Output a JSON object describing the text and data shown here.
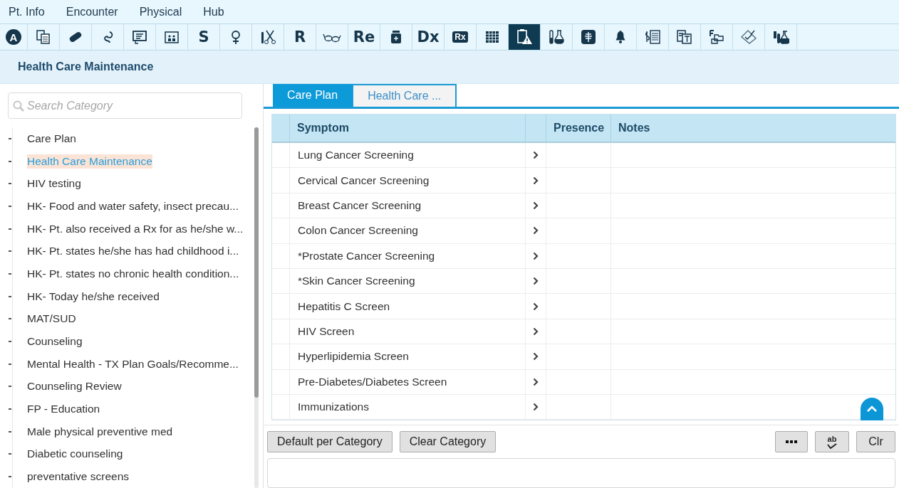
{
  "menu": [
    "Pt. Info",
    "Encounter",
    "Physical",
    "Hub"
  ],
  "toolbar": [
    {
      "kind": "circled",
      "label": "A",
      "selected": false
    },
    {
      "kind": "icon",
      "selected": false
    },
    {
      "kind": "icon",
      "selected": false
    },
    {
      "kind": "icon",
      "selected": false
    },
    {
      "kind": "icon",
      "selected": false
    },
    {
      "kind": "icon",
      "selected": false
    },
    {
      "kind": "letter",
      "label": "S",
      "selected": false
    },
    {
      "kind": "icon",
      "selected": false
    },
    {
      "kind": "icon",
      "selected": false
    },
    {
      "kind": "letter",
      "label": "R",
      "selected": false
    },
    {
      "kind": "icon",
      "selected": false
    },
    {
      "kind": "letter",
      "label": "Re",
      "selected": false
    },
    {
      "kind": "icon",
      "selected": false
    },
    {
      "kind": "letter",
      "label": "Dx",
      "selected": false
    },
    {
      "kind": "badge",
      "label": "Rx",
      "selected": false
    },
    {
      "kind": "icon",
      "selected": false
    },
    {
      "kind": "icon",
      "selected": true
    },
    {
      "kind": "icon",
      "selected": false
    },
    {
      "kind": "icon",
      "selected": false
    },
    {
      "kind": "icon",
      "selected": false
    },
    {
      "kind": "icon",
      "selected": false
    },
    {
      "kind": "icon",
      "selected": false
    },
    {
      "kind": "icon",
      "selected": false
    },
    {
      "kind": "icon",
      "selected": false
    },
    {
      "kind": "icon",
      "selected": false
    }
  ],
  "page_title": "Health Care Maintenance",
  "search": {
    "placeholder": "Search Category"
  },
  "categories": [
    {
      "label": "Care Plan",
      "selected": false
    },
    {
      "label": "Health Care Maintenance",
      "selected": true
    },
    {
      "label": "HIV testing",
      "selected": false
    },
    {
      "label": "HK- Food and water safety, insect precau...",
      "selected": false
    },
    {
      "label": "HK- Pt. also received a Rx for as he/she w...",
      "selected": false
    },
    {
      "label": "HK- Pt. states he/she has had childhood i...",
      "selected": false
    },
    {
      "label": "HK- Pt. states no chronic health condition...",
      "selected": false
    },
    {
      "label": "HK- Today he/she received",
      "selected": false
    },
    {
      "label": "MAT/SUD",
      "selected": false
    },
    {
      "label": "Counseling",
      "selected": false
    },
    {
      "label": "Mental Health - TX Plan Goals/Recomme...",
      "selected": false
    },
    {
      "label": "Counseling Review",
      "selected": false
    },
    {
      "label": "FP - Education",
      "selected": false
    },
    {
      "label": "Male physical preventive med",
      "selected": false
    },
    {
      "label": "Diabetic counseling",
      "selected": false
    },
    {
      "label": "preventative screens",
      "selected": false
    }
  ],
  "tabs": [
    {
      "label": "Care Plan",
      "selected": true
    },
    {
      "label": "Health Care ...",
      "selected": false
    }
  ],
  "table": {
    "columns": [
      "Symptom",
      "Presence",
      "Notes"
    ],
    "rows": [
      {
        "symptom": "Lung Cancer Screening"
      },
      {
        "symptom": "Cervical Cancer Screening"
      },
      {
        "symptom": "Breast Cancer Screening"
      },
      {
        "symptom": "Colon Cancer Screening"
      },
      {
        "symptom": "*Prostate Cancer Screening"
      },
      {
        "symptom": "*Skin Cancer Screening"
      },
      {
        "symptom": "Hepatitis C Screen"
      },
      {
        "symptom": "HIV Screen"
      },
      {
        "symptom": "Hyperlipidemia Screen"
      },
      {
        "symptom": "Pre-Diabetes/Diabetes Screen"
      },
      {
        "symptom": "Immunizations"
      }
    ]
  },
  "buttons_left": [
    "Default per Category",
    "Clear Category"
  ],
  "spell_label": "ab",
  "clear_label": "Clr"
}
